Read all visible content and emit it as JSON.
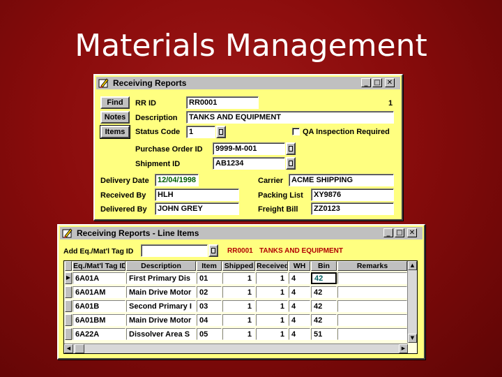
{
  "slide": {
    "title": "Materials Management"
  },
  "receiving_window": {
    "title": "Receiving Reports",
    "buttons": {
      "find": "Find",
      "notes": "Notes",
      "items": "Items"
    },
    "fields": {
      "rr_id": {
        "label": "RR ID",
        "value": "RR0001",
        "record_count": "1"
      },
      "description": {
        "label": "Description",
        "value": "TANKS AND EQUIPMENT"
      },
      "status_code": {
        "label": "Status Code",
        "value": "1"
      },
      "qa_inspection": {
        "label": "QA Inspection Required",
        "checked": false
      },
      "purchase_order_id": {
        "label": "Purchase Order ID",
        "value": "9999-M-001"
      },
      "shipment_id": {
        "label": "Shipment ID",
        "value": "AB1234"
      },
      "delivery_date": {
        "label": "Delivery Date",
        "value": "12/04/1998"
      },
      "carrier": {
        "label": "Carrier",
        "value": "ACME SHIPPING"
      },
      "received_by": {
        "label": "Received By",
        "value": "HLH"
      },
      "packing_list": {
        "label": "Packing List",
        "value": "XY9876"
      },
      "delivered_by": {
        "label": "Delivered By",
        "value": "JOHN GREY"
      },
      "freight_bill": {
        "label": "Freight Bill",
        "value": "ZZ0123"
      }
    }
  },
  "line_items_window": {
    "title": "Receiving Reports - Line Items",
    "add_label": "Add Eq./Mat'l Tag ID",
    "rr_id": "RR0001",
    "description": "TANKS AND EQUIPMENT",
    "columns": [
      "Eq./Mat'l Tag ID",
      "Description",
      "Item",
      "Shipped",
      "Received",
      "WH",
      "Bin",
      "Remarks"
    ],
    "rows": [
      [
        "6A01A",
        "First Primary Dis",
        "01",
        "1",
        "1",
        "4",
        "42",
        ""
      ],
      [
        "6A01AM",
        "Main Drive Motor",
        "02",
        "1",
        "1",
        "4",
        "42",
        ""
      ],
      [
        "6A01B",
        "Second Primary I",
        "03",
        "1",
        "1",
        "4",
        "42",
        ""
      ],
      [
        "6A01BM",
        "Main Drive Motor",
        "04",
        "1",
        "1",
        "4",
        "42",
        ""
      ],
      [
        "6A22A",
        "Dissolver Area S",
        "05",
        "1",
        "1",
        "4",
        "51",
        ""
      ]
    ]
  },
  "colors": {
    "background": "#8a0c0c",
    "form_fill": "#ffff80",
    "chrome": "#c0c0c0",
    "accent_red": "#b00000"
  }
}
